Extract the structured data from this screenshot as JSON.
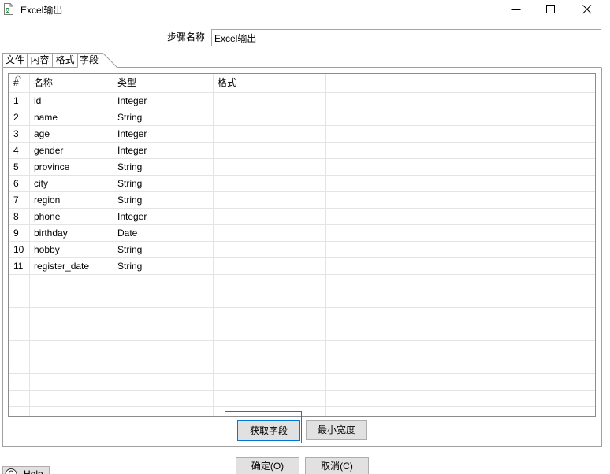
{
  "window": {
    "title": "Excel输出",
    "icon": "excel-output-step-icon",
    "controls": {
      "minimize": "minimize-icon",
      "maximize": "maximize-icon",
      "close": "close-icon"
    }
  },
  "step_name": {
    "label": "步骤名称",
    "value": "Excel输出"
  },
  "tabs": [
    {
      "label": "文件",
      "active": false
    },
    {
      "label": "内容",
      "active": false
    },
    {
      "label": "格式",
      "active": false
    },
    {
      "label": "字段",
      "active": true
    }
  ],
  "fields_table": {
    "sort_icon": "sort-ascending-icon",
    "columns": [
      "#",
      "名称",
      "类型",
      "格式"
    ],
    "rows": [
      {
        "num": "1",
        "name": "id",
        "type": "Integer",
        "format": ""
      },
      {
        "num": "2",
        "name": "name",
        "type": "String",
        "format": ""
      },
      {
        "num": "3",
        "name": "age",
        "type": "Integer",
        "format": ""
      },
      {
        "num": "4",
        "name": "gender",
        "type": "Integer",
        "format": ""
      },
      {
        "num": "5",
        "name": "province",
        "type": "String",
        "format": ""
      },
      {
        "num": "6",
        "name": "city",
        "type": "String",
        "format": ""
      },
      {
        "num": "7",
        "name": "region",
        "type": "String",
        "format": ""
      },
      {
        "num": "8",
        "name": "phone",
        "type": "Integer",
        "format": ""
      },
      {
        "num": "9",
        "name": "birthday",
        "type": "Date",
        "format": ""
      },
      {
        "num": "10",
        "name": "hobby",
        "type": "String",
        "format": ""
      },
      {
        "num": "11",
        "name": "register_date",
        "type": "String",
        "format": ""
      }
    ]
  },
  "panel_buttons": {
    "get_fields": "获取字段",
    "min_width": "最小宽度"
  },
  "dialog_buttons": {
    "ok": "确定(O)",
    "cancel": "取消(C)",
    "help": "Help",
    "help_icon": "help-icon"
  },
  "colors": {
    "highlight": "#d9302c",
    "focus_border": "#0078d7",
    "button_bg": "#e1e1e1",
    "button_border": "#adadad",
    "frame_border": "#a0a0a0"
  }
}
